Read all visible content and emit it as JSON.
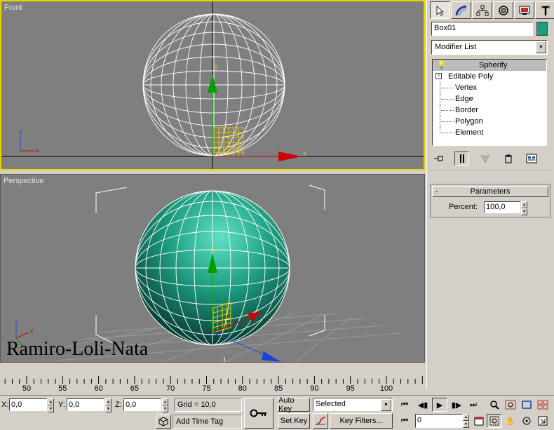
{
  "viewports": {
    "front": {
      "label": "Front",
      "axis_x": "x",
      "axis_z": "z",
      "axis_y": "y"
    },
    "perspective": {
      "label": "Perspective",
      "axis_x": "x",
      "axis_z": "z",
      "axis_y": "y"
    }
  },
  "watermark": "Ramiro-Loli-Nata",
  "command_panel": {
    "tabs": [
      {
        "icon": "create-icon",
        "active": true
      },
      {
        "icon": "modify-icon",
        "active": false
      },
      {
        "icon": "hierarchy-icon",
        "active": false
      },
      {
        "icon": "motion-icon",
        "active": false
      },
      {
        "icon": "display-icon",
        "active": false
      },
      {
        "icon": "utilities-icon",
        "active": false
      }
    ],
    "object_name": "Box01",
    "object_color": "#1e9d80",
    "modifier_list": "Modifier List",
    "stack": [
      {
        "label": "Spherify",
        "selected": true,
        "icon": "lightbulb-icon"
      },
      {
        "label": "Editable Poly",
        "selected": false,
        "icon": "minus-box-icon"
      },
      {
        "label": "Vertex",
        "selected": false
      },
      {
        "label": "Edge",
        "selected": false
      },
      {
        "label": "Border",
        "selected": false
      },
      {
        "label": "Polygon",
        "selected": false
      },
      {
        "label": "Element",
        "selected": false
      }
    ],
    "rollout": {
      "title": "Parameters",
      "collapse": "-",
      "percent_label": "Percent:",
      "percent_value": "100,0"
    }
  },
  "timeline": {
    "ticks": [
      "50",
      "55",
      "60",
      "65",
      "70",
      "75",
      "80",
      "85",
      "90",
      "95",
      "100"
    ]
  },
  "status_bar": {
    "x_label": "X:",
    "x_value": "0,0",
    "y_label": "Y:",
    "y_value": "0,0",
    "z_label": "Z:",
    "z_value": "0,0",
    "grid": "Grid = 10,0",
    "add_time_tag": "Add Time Tag",
    "auto_key": "Auto Key",
    "set_key": "Set Key",
    "selected": "Selected",
    "key_filters": "Key Filters...",
    "current_frame": "0"
  },
  "colors": {
    "viewport_bg": "#7f7f7f",
    "active_border": "#e5d600",
    "sphere": "#1e9d80",
    "gizmo_yellow": "#e6c800"
  }
}
